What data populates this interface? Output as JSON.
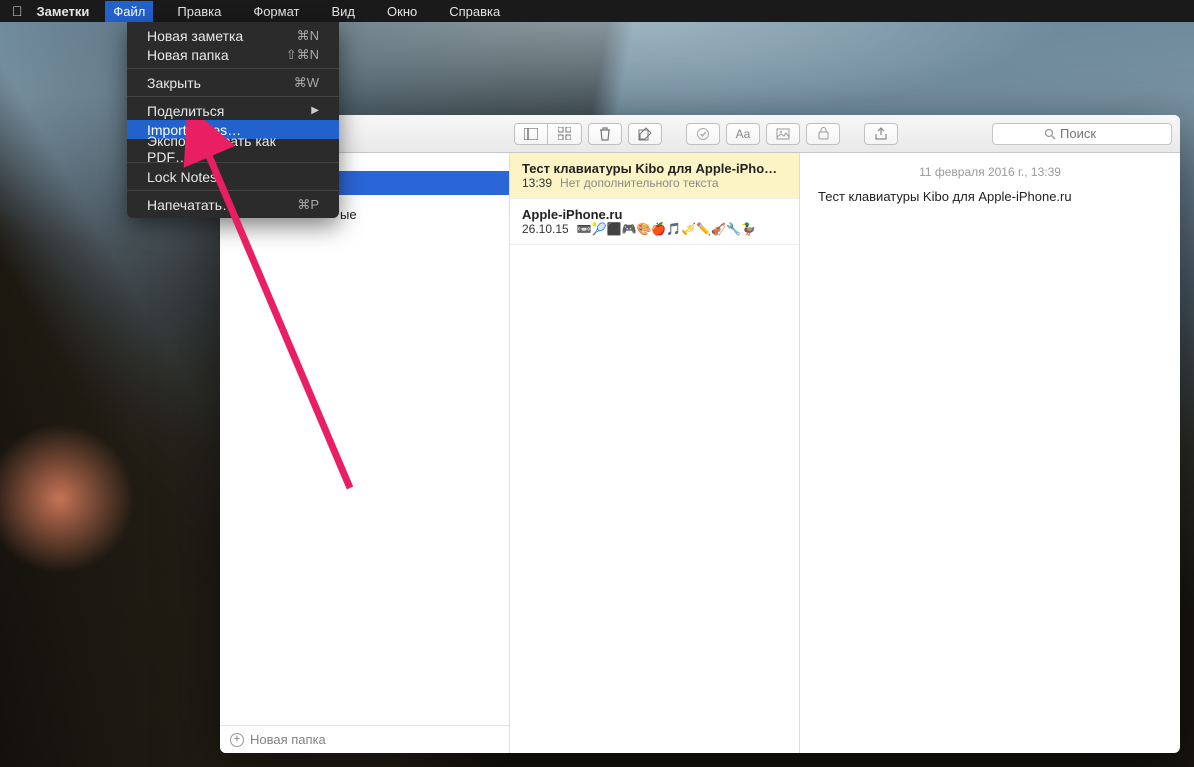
{
  "menubar": {
    "app_name": "Заметки",
    "items": [
      "Файл",
      "Правка",
      "Формат",
      "Вид",
      "Окно",
      "Справка"
    ],
    "active_index": 0
  },
  "dropdown": {
    "groups": [
      [
        {
          "label": "Новая заметка",
          "shortcut": "⌘N"
        },
        {
          "label": "Новая папка",
          "shortcut": "⇧⌘N"
        }
      ],
      [
        {
          "label": "Закрыть",
          "shortcut": "⌘W"
        }
      ],
      [
        {
          "label": "Поделиться",
          "submenu": true
        },
        {
          "label": "Import Notes…",
          "highlight": true
        },
        {
          "label": "Экспортировать как PDF…"
        }
      ],
      [
        {
          "label": "Lock Notes"
        }
      ],
      [
        {
          "label": "Напечатать…",
          "shortcut": "⌘P"
        }
      ]
    ]
  },
  "partial_text": "ые",
  "toolbar": {
    "icons": [
      "list-view",
      "grid-view",
      "trash",
      "compose",
      "checklist",
      "Aa",
      "attachment",
      "lock",
      "share"
    ],
    "aa_label": "Aa",
    "search_placeholder": "Поиск"
  },
  "sidebar": {
    "selected_folder": "",
    "footer": "Новая папка"
  },
  "notes": [
    {
      "title": "Тест клавиатуры Kibo для Apple-iPho…",
      "time": "13:39",
      "extra": "Нет дополнительного текста",
      "selected": true
    },
    {
      "title": "Apple-iPhone.ru",
      "time": "26.10.15",
      "extra": "📼🎾⬛🎮🎨🍎🎵🎺✏️🎻🔧🦆",
      "selected": false
    }
  ],
  "editor": {
    "date": "11 февраля 2016 г., 13:39",
    "body": "Тест клавиатуры Kibo для Apple-iPhone.ru"
  }
}
